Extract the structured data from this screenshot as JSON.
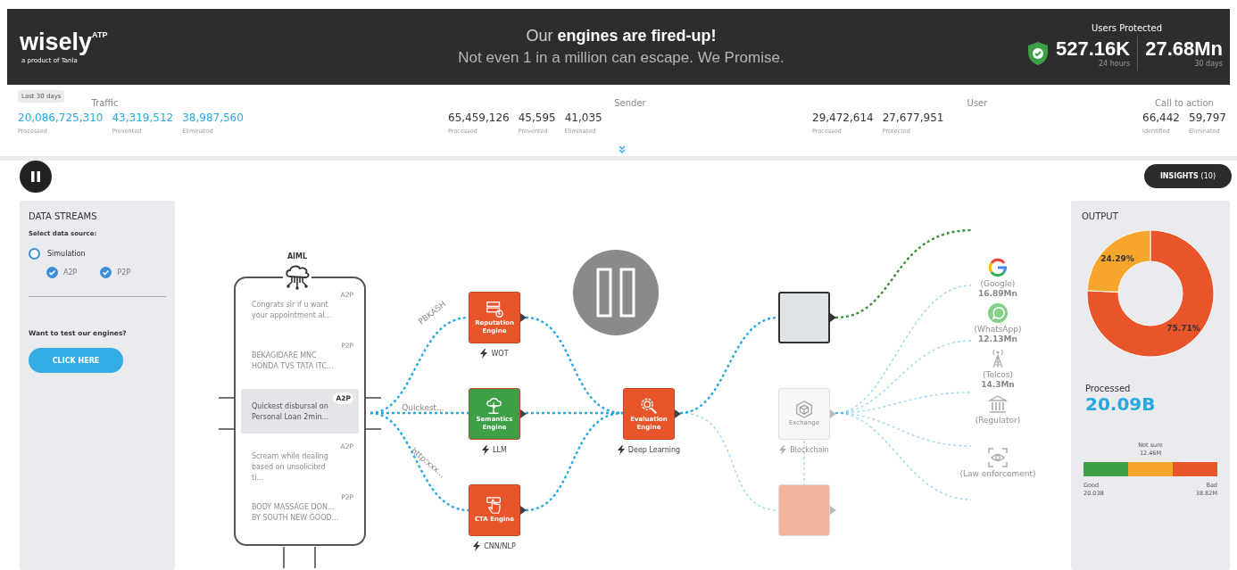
{
  "header": {
    "logo": "wisely$^{ATP}$",
    "tagline": "a product of Tanla",
    "headline": "Our **engines are fired-up!**",
    "subline": "Not even 1 in a million can escape. We Promise.",
    "users_protected": {
      "title": "Users Protected",
      "stats": [
        {
          "value": "527.16K",
          "period": "24 hours"
        },
        {
          "value": "27.68Mn",
          "period": "30 days"
        }
      ]
    }
  },
  "summary": {
    "range": "Last 30 days",
    "groups": [
      {
        "title": "Traffic",
        "accent": true,
        "stats": [
          {
            "value": "20,086,725,310",
            "caption": "Processed"
          },
          {
            "value": "43,319,512",
            "caption": "Prevented"
          },
          {
            "value": "38,987,560",
            "caption": "Eliminated"
          }
        ]
      },
      {
        "title": "Sender",
        "accent": false,
        "stats": [
          {
            "value": "65,459,126",
            "caption": "Processed"
          },
          {
            "value": "45,595",
            "caption": "Prevented"
          },
          {
            "value": "41,035",
            "caption": "Eliminated"
          }
        ]
      },
      {
        "title": "User",
        "accent": false,
        "stats": [
          {
            "value": "29,472,614",
            "caption": "Processed"
          },
          {
            "value": "27,677,951",
            "caption": "Protected"
          }
        ]
      },
      {
        "title": "Call to action",
        "accent": false,
        "stats": [
          {
            "value": "66,442",
            "caption": "Identified"
          },
          {
            "value": "59,797",
            "caption": "Eliminated"
          }
        ]
      }
    ]
  },
  "toolbar": {
    "insights": "INSIGHTS",
    "insights_count": "(10)"
  },
  "data_streams": {
    "title": "DATA STREAMS",
    "prompt": "Select data source:",
    "source": {
      "label": "Simulation",
      "selected": false
    },
    "channels": [
      {
        "label": "A2P",
        "checked": true
      },
      {
        "label": "P2P",
        "checked": true
      }
    ],
    "cta_text": "Want to test our engines?",
    "cta_button": "CLICK HERE"
  },
  "flow": {
    "source_label": "AIML",
    "messages": [
      {
        "text": "Congrats sir if u want your appointment al...",
        "tag": "A2P",
        "selected": false
      },
      {
        "text": "BEKAGIDARE MNC HONDA TVS TATA ITC...",
        "tag": "P2P",
        "selected": false
      },
      {
        "text": "Quickest disbursal on Personal Loan 2min...",
        "tag": "A2P",
        "selected": true
      },
      {
        "text": "Scream while dealing based on unsolicited ti...",
        "tag": "A2P",
        "selected": false
      },
      {
        "text": "BODY MASSAGE DON... BY SOUTH NEW GOOD...",
        "tag": "P2P",
        "selected": false
      }
    ],
    "edge_labels": [
      "PBKASH",
      "Quickest...",
      "http:xxx..."
    ],
    "nodes": [
      {
        "kind": "engine",
        "title": "Reputation Engine",
        "model": "WOT",
        "color": "#e8552b"
      },
      {
        "kind": "engine",
        "title": "Semantics Engine",
        "model": "LLM",
        "color": "#3d9f46"
      },
      {
        "kind": "engine",
        "title": "CTA Engine",
        "model": "CNN/NLP",
        "color": "#e8552b"
      },
      {
        "kind": "engine",
        "title": "Evaluation Engine",
        "model": "Deep Learning",
        "color": "#e8552b"
      },
      {
        "kind": "outlined",
        "color": "#dfe2e6"
      },
      {
        "kind": "faint",
        "title": "Exchange",
        "model": "Blockchain",
        "color": "#f7f7f7"
      },
      {
        "kind": "faint",
        "color": "#f5b39d"
      }
    ],
    "channels": [
      {
        "kind": "google",
        "label": "(Google)",
        "count": "16.89Mn"
      },
      {
        "kind": "whatsapp",
        "label": "(WhatsApp)",
        "count": "12.13Mn"
      },
      {
        "kind": "telco",
        "label": "(Telcos)",
        "count": "14.3Mn"
      },
      {
        "kind": "regulator",
        "label": "(Regulator)"
      },
      {
        "kind": "law",
        "label": "(Law enforcement)"
      }
    ]
  },
  "output": {
    "title": "OUTPUT",
    "chart_data": {
      "type": "donut",
      "values": [
        75.71,
        24.29
      ],
      "colors": [
        "#e8552b",
        "#f5a62b"
      ],
      "value_labels": [
        "75.71%",
        "24.29%"
      ]
    },
    "processed_label": "Processed",
    "processed_value": "20.09B",
    "breakdown": [
      {
        "label": "Good",
        "value": "20.03B",
        "color": "#3d9f46"
      },
      {
        "label": "Not sure",
        "value": "12.46M",
        "color": "#f5a62b"
      },
      {
        "label": "Bad",
        "value": "38.82M",
        "color": "#e8552b"
      }
    ]
  }
}
